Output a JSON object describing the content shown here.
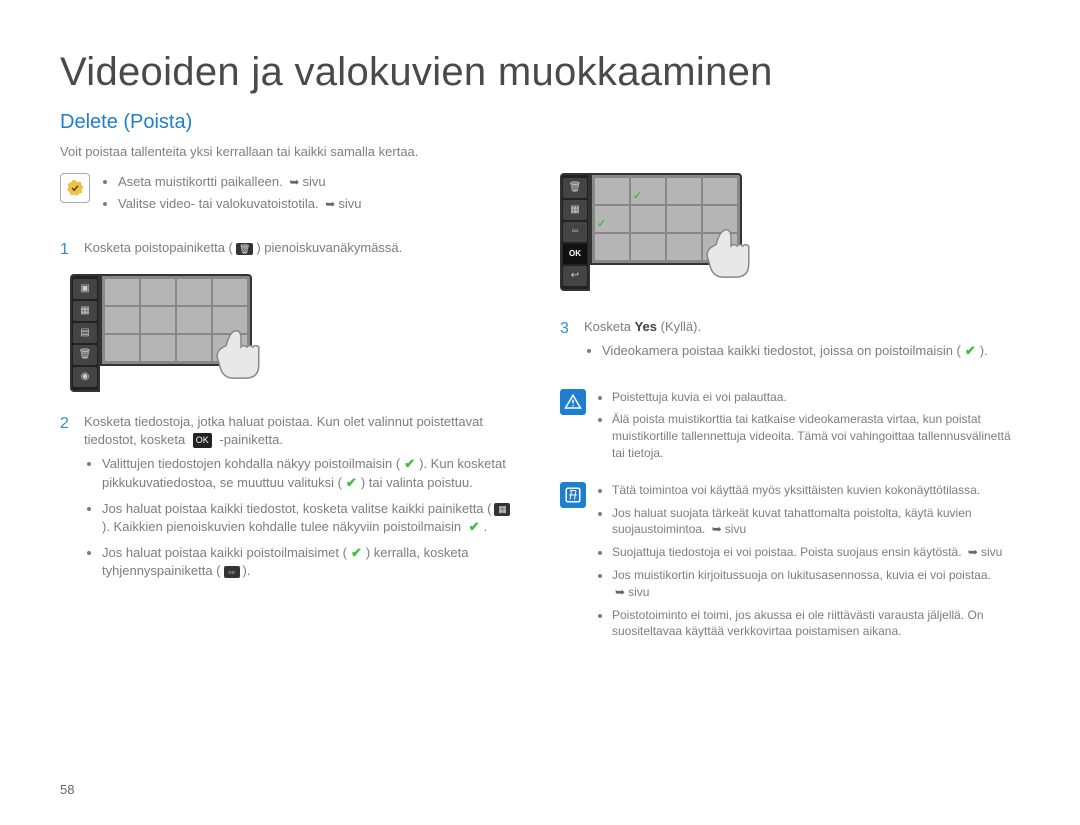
{
  "title": "Videoiden ja valokuvien muokkaaminen",
  "subtitle": "Delete (Poista)",
  "intro": "Voit poistaa tallenteita yksi kerrallaan tai kaikki samalla kertaa.",
  "prereq": {
    "items": [
      "Aseta muistikortti paikalleen.",
      "Valitse video- tai valokuvatoistotila."
    ],
    "page_ref": "sivu"
  },
  "steps": {
    "s1": {
      "num": "1",
      "text_a": "Kosketa poistopainiketta (",
      "text_b": ") pienoiskuvanäkymässä."
    },
    "s2": {
      "num": "2",
      "text_a": "Kosketa tiedostoja, jotka haluat poistaa. Kun olet valinnut poistettavat tiedostot, kosketa ",
      "text_b": " -painiketta.",
      "b1a": "Valittujen tiedostojen kohdalla näkyy poistoilmaisin (",
      "b1b": "). Kun kosketat pikkukuvatiedostoa, se muuttuu valituksi (",
      "b1c": ") tai valinta poistuu.",
      "b2a": "Jos haluat poistaa kaikki tiedostot, kosketa valitse kaikki painiketta (",
      "b2b": "). Kaikkien pienoiskuvien kohdalle tulee näkyviin poistoilmaisin ",
      "b2c": ".",
      "b3a": "Jos haluat poistaa kaikki poistoilmaisimet (",
      "b3b": ") kerralla, kosketa tyhjennyspainiketta (",
      "b3c": ")."
    },
    "s3": {
      "num": "3",
      "text_a": "Kosketa ",
      "yes": "Yes",
      "text_b": " (Kyllä).",
      "b1a": "Videokamera poistaa kaikki tiedostot, joissa on poistoilmaisin (",
      "b1b": ")."
    }
  },
  "warn": {
    "b1": "Poistettuja kuvia ei voi palauttaa.",
    "b2": "Älä poista muistikorttia tai katkaise videokamerasta virtaa, kun poistat muistikortille tallennettuja videoita. Tämä voi vahingoittaa tallennusvälinettä tai tietoja."
  },
  "info": {
    "b1": "Tätä toimintoa voi käyttää myös yksittäisten kuvien kokonäyttötilassa.",
    "b2a": "Jos haluat suojata tärkeät kuvat tahattomalta poistolta, käytä kuvien suojaustoimintoa. ",
    "b2b": "sivu",
    "b3a": "Suojattuja tiedostoja ei voi poistaa. Poista suojaus ensin käytöstä. ",
    "b3b": "sivu",
    "b4a": "Jos muistikortin kirjoitussuoja on lukitusasennossa, kuvia ei voi poistaa. ",
    "b4b": "sivu",
    "b5": "Poistotoiminto ei toimi, jos akussa ei ole riittävästi varausta jäljellä. On suositeltavaa käyttää verkkovirtaa poistamisen aikana."
  },
  "page_number": "58"
}
